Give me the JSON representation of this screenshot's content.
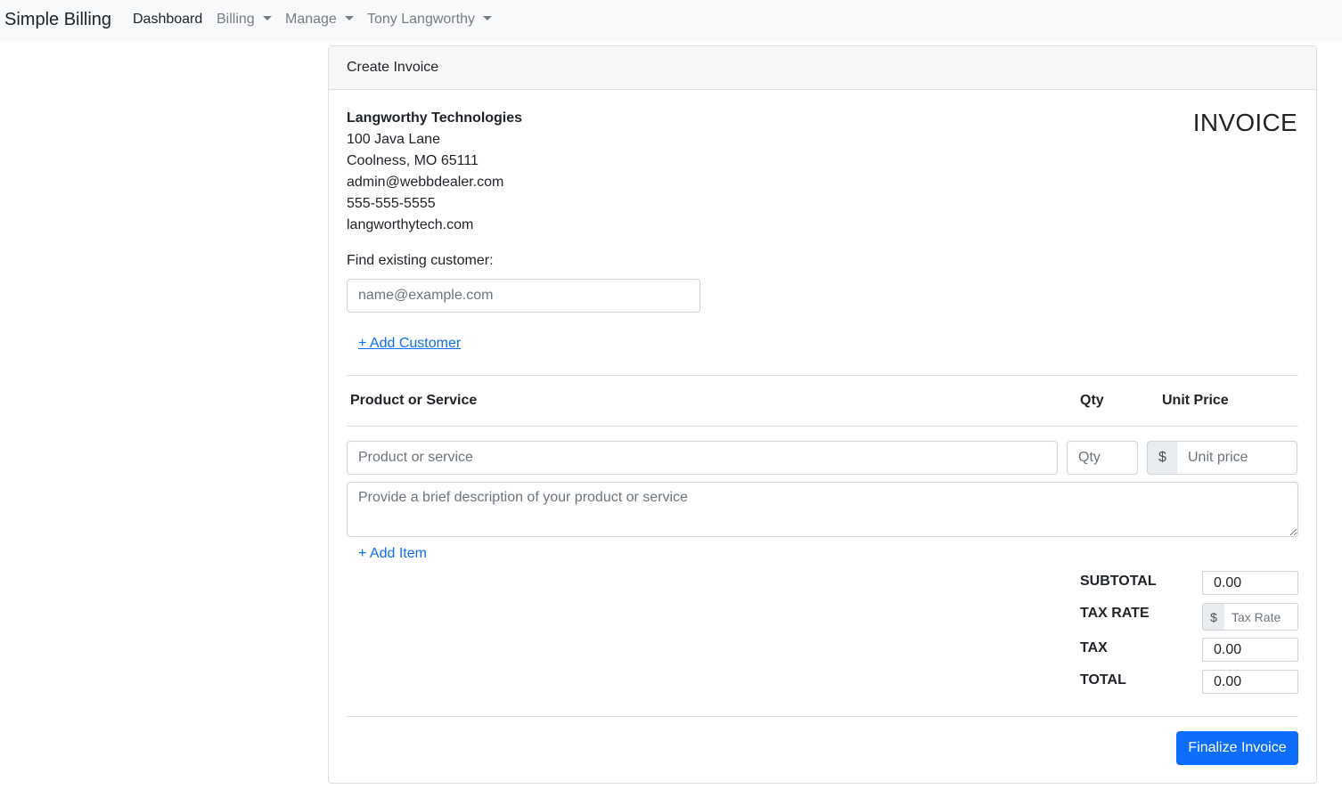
{
  "navbar": {
    "brand": "Simple Billing",
    "items": [
      {
        "label": "Dashboard"
      },
      {
        "label": "Billing"
      },
      {
        "label": "Manage"
      },
      {
        "label": "Tony Langworthy"
      }
    ]
  },
  "card": {
    "title": "Create Invoice"
  },
  "company": {
    "name": "Langworthy Technologies",
    "address_line1": "100 Java Lane",
    "address_line2": "Coolness, MO 65111",
    "email": "admin@webbdealer.com",
    "phone": "555-555-5555",
    "website": "langworthytech.com"
  },
  "invoice_heading": "INVOICE",
  "customer": {
    "find_label": "Find existing customer:",
    "search_placeholder": "name@example.com",
    "add_link": "+ Add Customer"
  },
  "items_table": {
    "headers": {
      "product": "Product or Service",
      "qty": "Qty",
      "unit_price": "Unit Price"
    },
    "product_placeholder": "Product or service",
    "qty_placeholder": "Qty",
    "currency_symbol": "$",
    "unit_price_placeholder": "Unit price",
    "description_placeholder": "Provide a brief description of your product or service",
    "add_item_link": "+ Add Item"
  },
  "totals": {
    "subtotal_label": "SUBTOTAL",
    "subtotal_value": "0.00",
    "tax_rate_label": "TAX RATE",
    "tax_rate_symbol": "$",
    "tax_rate_placeholder": "Tax Rate",
    "tax_label": "TAX",
    "tax_value": "0.00",
    "total_label": "TOTAL",
    "total_value": "0.00"
  },
  "actions": {
    "finalize_label": "Finalize Invoice"
  },
  "colors": {
    "primary": "#0d6efd",
    "navbar_bg": "#f8f9fa",
    "card_header_bg": "#f7f7f7"
  }
}
